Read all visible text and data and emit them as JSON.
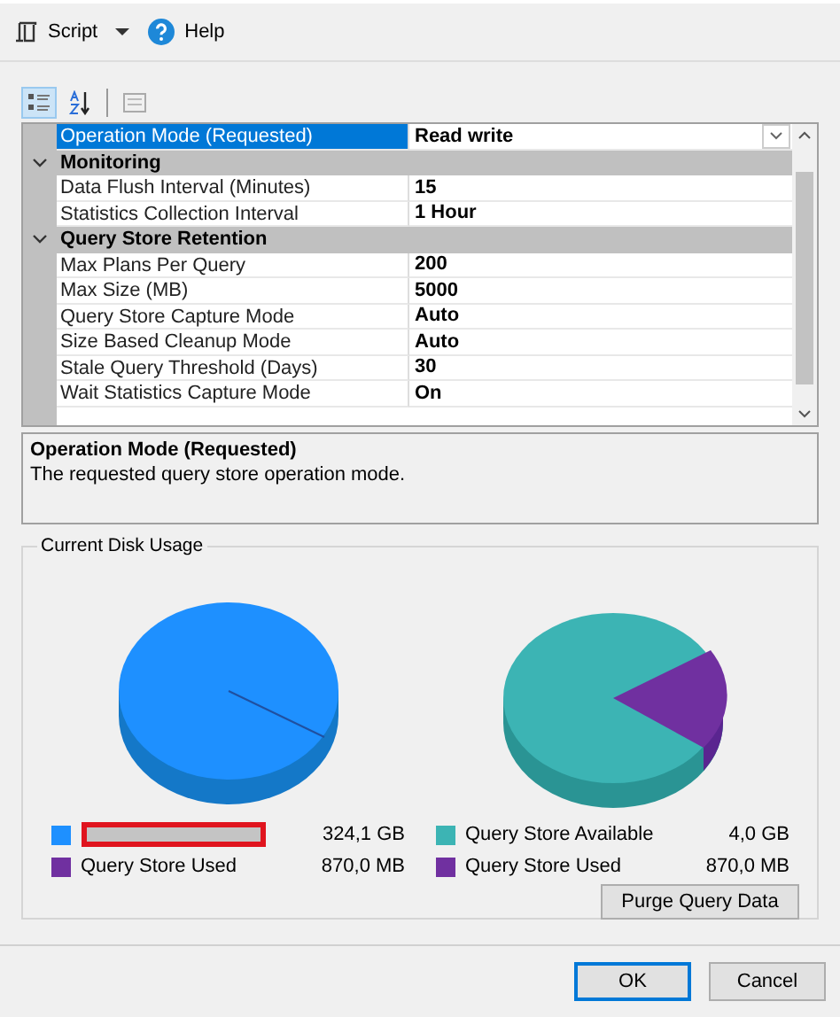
{
  "toolbar": [
    {
      "kind": "script",
      "label": "Script"
    },
    {
      "kind": "help",
      "label": "Help"
    }
  ],
  "grid_toolbar": [
    {
      "kind": "categorized",
      "selected": true
    },
    {
      "kind": "alphabetical",
      "selected": false
    },
    {
      "kind": "pages",
      "selected": false
    }
  ],
  "properties": [
    {
      "kind": "row",
      "name": "Operation Mode (Requested)",
      "value": "Read write",
      "selected": true,
      "dropdown": true
    },
    {
      "kind": "category",
      "name": "Monitoring",
      "expanded": true
    },
    {
      "kind": "row",
      "name": "Data Flush Interval (Minutes)",
      "value": "15",
      "selected": false
    },
    {
      "kind": "row",
      "name": "Statistics Collection Interval",
      "value": "1 Hour",
      "selected": false
    },
    {
      "kind": "category",
      "name": "Query Store Retention",
      "expanded": true
    },
    {
      "kind": "row",
      "name": "Max Plans Per Query",
      "value": "200",
      "selected": false
    },
    {
      "kind": "row",
      "name": "Max Size (MB)",
      "value": "5000",
      "selected": false
    },
    {
      "kind": "row",
      "name": "Query Store Capture Mode",
      "value": "Auto",
      "selected": false
    },
    {
      "kind": "row",
      "name": "Size Based Cleanup Mode",
      "value": "Auto",
      "selected": false
    },
    {
      "kind": "row",
      "name": "Stale Query Threshold (Days)",
      "value": "30",
      "selected": false
    },
    {
      "kind": "row",
      "name": "Wait Statistics Capture Mode",
      "value": "On",
      "selected": false
    }
  ],
  "description": {
    "title": "Operation Mode (Requested)",
    "text": "The requested query store operation mode."
  },
  "disk_usage": {
    "title": "Current Disk Usage",
    "legends": [
      [
        {
          "redacted": true,
          "color": "#1e90ff",
          "value": "324,1 GB"
        },
        {
          "label": "Query Store Used",
          "color": "#7030a0",
          "value": "870,0 MB"
        }
      ],
      [
        {
          "label": "Query Store Available",
          "color": "#3cb4b4",
          "value": "4,0 GB"
        },
        {
          "label": "Query Store Used",
          "color": "#7030a0",
          "value": "870,0 MB"
        }
      ]
    ],
    "purge_button": "Purge Query Data"
  },
  "buttons": [
    {
      "label": "OK",
      "default": true
    },
    {
      "label": "Cancel",
      "default": false
    }
  ]
}
